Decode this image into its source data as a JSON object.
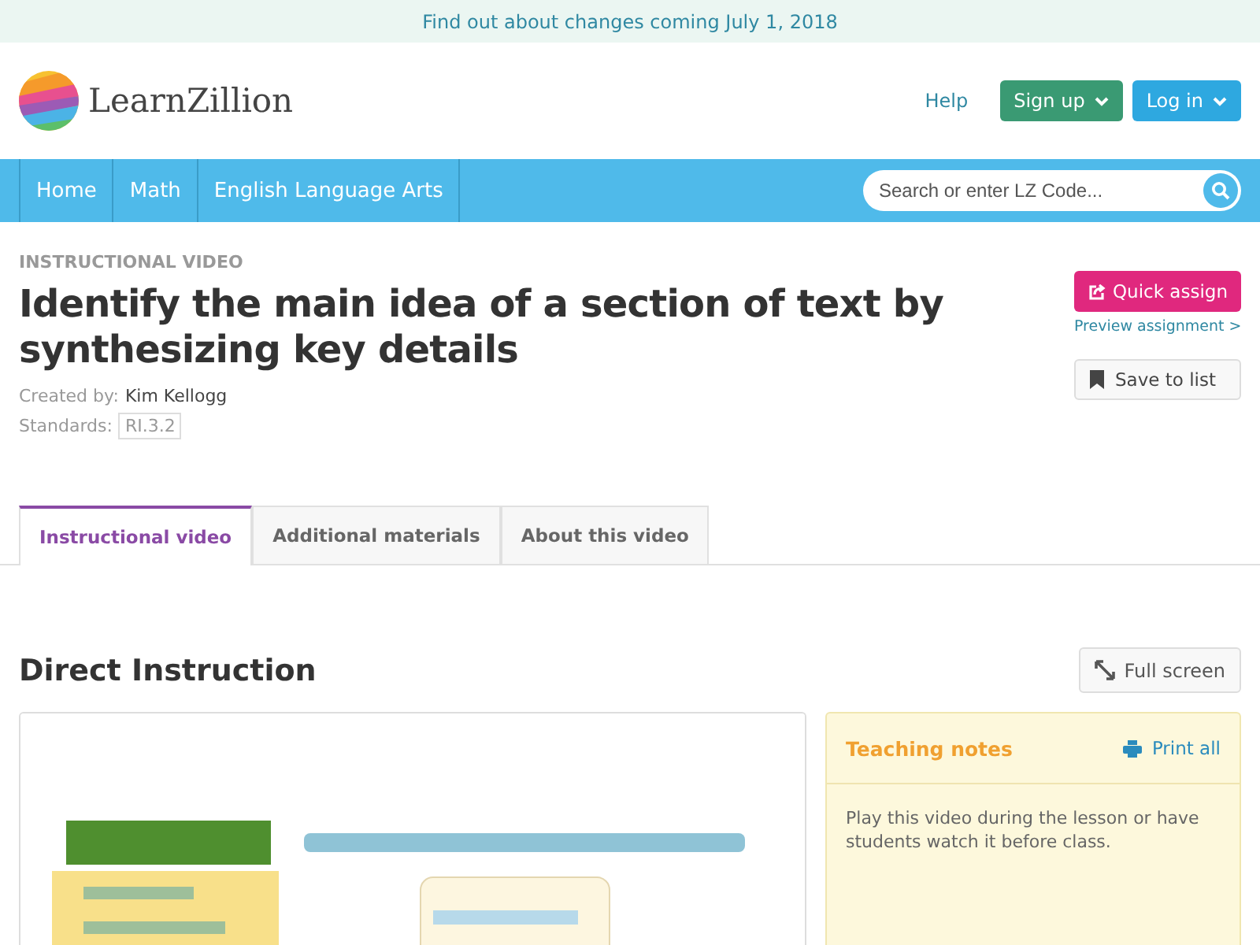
{
  "banner": {
    "text": "Find out about changes coming July 1, 2018"
  },
  "header": {
    "logo_text": "LearnZillion",
    "help": "Help",
    "buttons": [
      {
        "label": "Sign up",
        "kind": "signup"
      },
      {
        "label": "Log in",
        "kind": "login"
      }
    ]
  },
  "nav": {
    "items": [
      "Home",
      "Math",
      "English Language Arts"
    ],
    "search": {
      "placeholder": "Search or enter LZ Code..."
    }
  },
  "lesson": {
    "type_label": "INSTRUCTIONAL VIDEO",
    "title": "Identify the main idea of a section of text by synthesizing key details",
    "created_by_label": "Created by:",
    "author": "Kim Kellogg",
    "standards_label": "Standards:",
    "standards": [
      "RI.3.2"
    ],
    "quick_assign": "Quick assign",
    "preview": "Preview assignment >",
    "save": "Save to list"
  },
  "tabs": [
    {
      "label": "Instructional video",
      "selected": true
    },
    {
      "label": "Additional materials",
      "selected": false
    },
    {
      "label": "About this video",
      "selected": false
    }
  ],
  "section": {
    "title": "Direct Instruction",
    "fullscreen": "Full screen"
  },
  "notes": {
    "title": "Teaching notes",
    "print": "Print all",
    "text": "Play this video during the lesson or have students watch it before class."
  }
}
